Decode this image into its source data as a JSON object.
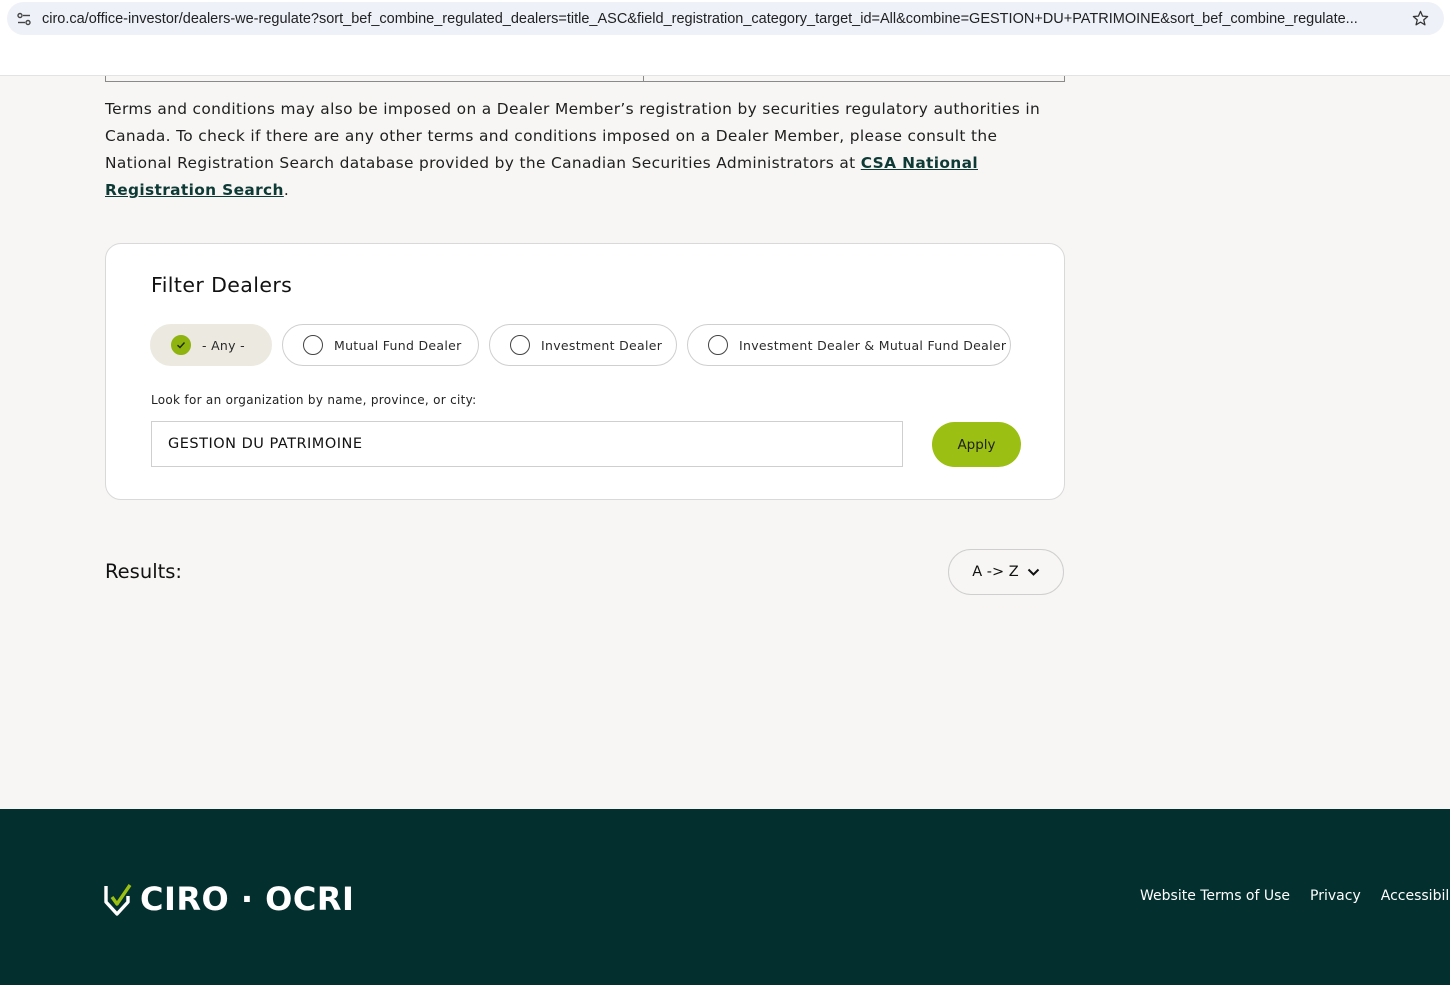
{
  "browser": {
    "url": "ciro.ca/office-investor/dealers-we-regulate?sort_bef_combine_regulated_dealers=title_ASC&field_registration_category_target_id=All&combine=GESTION+DU+PATRIMOINE&sort_bef_combine_regulate..."
  },
  "terms": {
    "text": "Terms and conditions may also be imposed on a Dealer Member’s registration by securities regulatory authorities in Canada. To check if there are any other terms and conditions imposed on a Dealer Member, please consult the National Registration Search database provided by the Canadian Securities Administrators at ",
    "link_label": "CSA National Registration Search",
    "end": "."
  },
  "filter": {
    "title": "Filter Dealers",
    "options": [
      {
        "label": "- Any -",
        "selected": true
      },
      {
        "label": "Mutual Fund Dealer",
        "selected": false
      },
      {
        "label": "Investment Dealer",
        "selected": false
      },
      {
        "label": "Investment Dealer & Mutual Fund Dealer",
        "selected": false
      }
    ],
    "search_label": "Look for an organization by name, province, or city:",
    "search_value": "GESTION DU PATRIMOINE",
    "apply_label": "Apply"
  },
  "results": {
    "label": "Results:",
    "sort_value": "A -> Z"
  },
  "footer": {
    "logo_text": "CIRO · OCRI",
    "links": [
      "Website Terms of Use",
      "Privacy",
      "Accessibility"
    ]
  },
  "colors": {
    "accent": "#9bbf12",
    "footer_bg": "#032f2e",
    "link": "#0e3a36"
  }
}
